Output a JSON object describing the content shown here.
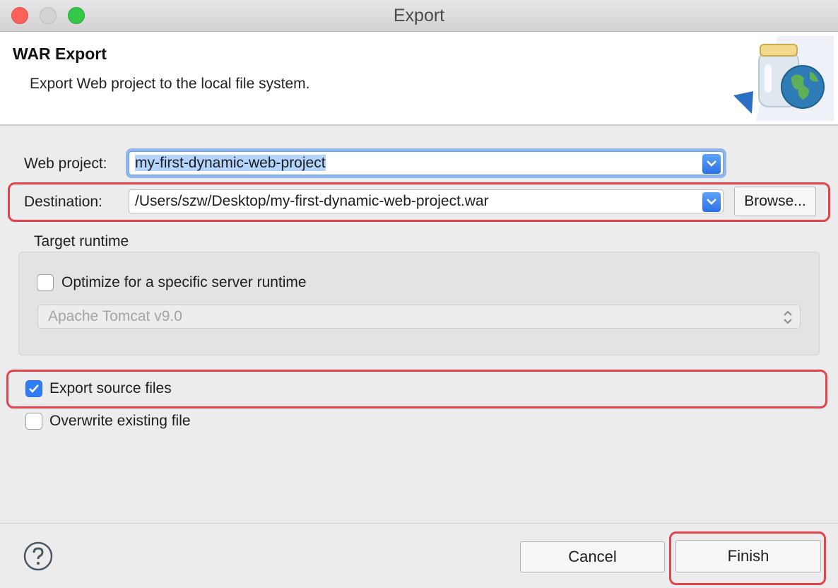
{
  "window": {
    "title": "Export"
  },
  "header": {
    "title": "WAR Export",
    "description": "Export Web project to the local file system."
  },
  "form": {
    "web_project_label": "Web project:",
    "web_project_value": "my-first-dynamic-web-project",
    "destination_label": "Destination:",
    "destination_value": "/Users/szw/Desktop/my-first-dynamic-web-project.war",
    "browse_label": "Browse..."
  },
  "target_runtime": {
    "group_label": "Target runtime",
    "optimize_label": "Optimize for a specific server runtime",
    "optimize_checked": false,
    "runtime_value": "Apache Tomcat v9.0"
  },
  "options": {
    "export_source_label": "Export source files",
    "export_source_checked": true,
    "overwrite_label": "Overwrite existing file",
    "overwrite_checked": false
  },
  "footer": {
    "cancel_label": "Cancel",
    "finish_label": "Finish"
  },
  "colors": {
    "highlight": "#e5434b",
    "accent": "#2f7cf6",
    "selection": "#b3d4fd"
  }
}
